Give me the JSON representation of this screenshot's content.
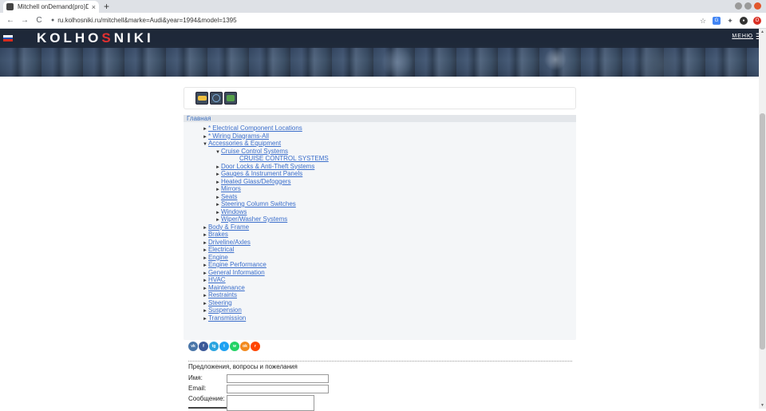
{
  "browser": {
    "tab_title": "Mitchell onDemand(pro)D",
    "tab_close": "×",
    "new_tab": "+",
    "back": "←",
    "forward": "→",
    "reload": "C",
    "url": "ru.kolhosniki.ru/mitchell&marke=Audi&year=1994&model=1395",
    "bookmark_star": "☆"
  },
  "header": {
    "logo_a": "KOLHO",
    "logo_s": "S",
    "logo_b": "NIKI",
    "menu_label": "МЕНЮ",
    "flag_colors": [
      "#ffffff",
      "#1a4fb4",
      "#d52b1e"
    ]
  },
  "breadcrumb": "Главная",
  "tree": [
    {
      "label": "* Electrical Component Locations",
      "arrow": "►"
    },
    {
      "label": "* Wiring Diagrams-All",
      "arrow": "►"
    },
    {
      "label": "Accessories & Equipment",
      "arrow": "▼"
    },
    {
      "label": "Cruise Control Systems",
      "arrow": "▼"
    },
    {
      "label": "CRUISE CONTROL SYSTEMS",
      "arrow": ""
    },
    {
      "label": "Door Locks & Anti-Theft Systems",
      "arrow": "►"
    },
    {
      "label": "Gauges & Instrument Panels",
      "arrow": "►"
    },
    {
      "label": "Heated Glass/Defoggers",
      "arrow": "►"
    },
    {
      "label": "Mirrors",
      "arrow": "►"
    },
    {
      "label": "Seats",
      "arrow": "►"
    },
    {
      "label": "Steering Column Switches",
      "arrow": "►"
    },
    {
      "label": "Windows",
      "arrow": "►"
    },
    {
      "label": "Wiper/Washer Systems",
      "arrow": "►"
    },
    {
      "label": "Body & Frame",
      "arrow": "►"
    },
    {
      "label": "Brakes",
      "arrow": "►"
    },
    {
      "label": "Driveline/Axles",
      "arrow": "►"
    },
    {
      "label": "Electrical",
      "arrow": "►"
    },
    {
      "label": "Engine",
      "arrow": "►"
    },
    {
      "label": "Engine Performance",
      "arrow": "►"
    },
    {
      "label": "General Information",
      "arrow": "►"
    },
    {
      "label": "HVAC",
      "arrow": "►"
    },
    {
      "label": "Maintenance",
      "arrow": "►"
    },
    {
      "label": "Restraints",
      "arrow": "►"
    },
    {
      "label": "Steering",
      "arrow": "►"
    },
    {
      "label": "Suspension",
      "arrow": "►"
    },
    {
      "label": "Transmission",
      "arrow": "►"
    }
  ],
  "social": [
    {
      "glyph": "vk",
      "color": "#4a76a8"
    },
    {
      "glyph": "f",
      "color": "#3b5998"
    },
    {
      "glyph": "tg",
      "color": "#2ca5e0"
    },
    {
      "glyph": "t",
      "color": "#1da1f2"
    },
    {
      "glyph": "w",
      "color": "#25d366"
    },
    {
      "glyph": "ok",
      "color": "#f28a20"
    },
    {
      "glyph": "r",
      "color": "#ff4500"
    }
  ],
  "feedback": {
    "title": "Предложения, вопросы и пожелания",
    "name_label": "Имя:",
    "email_label": "Email:",
    "message_label": "Сообщение:",
    "name_value": "",
    "email_value": "",
    "message_value": ""
  }
}
